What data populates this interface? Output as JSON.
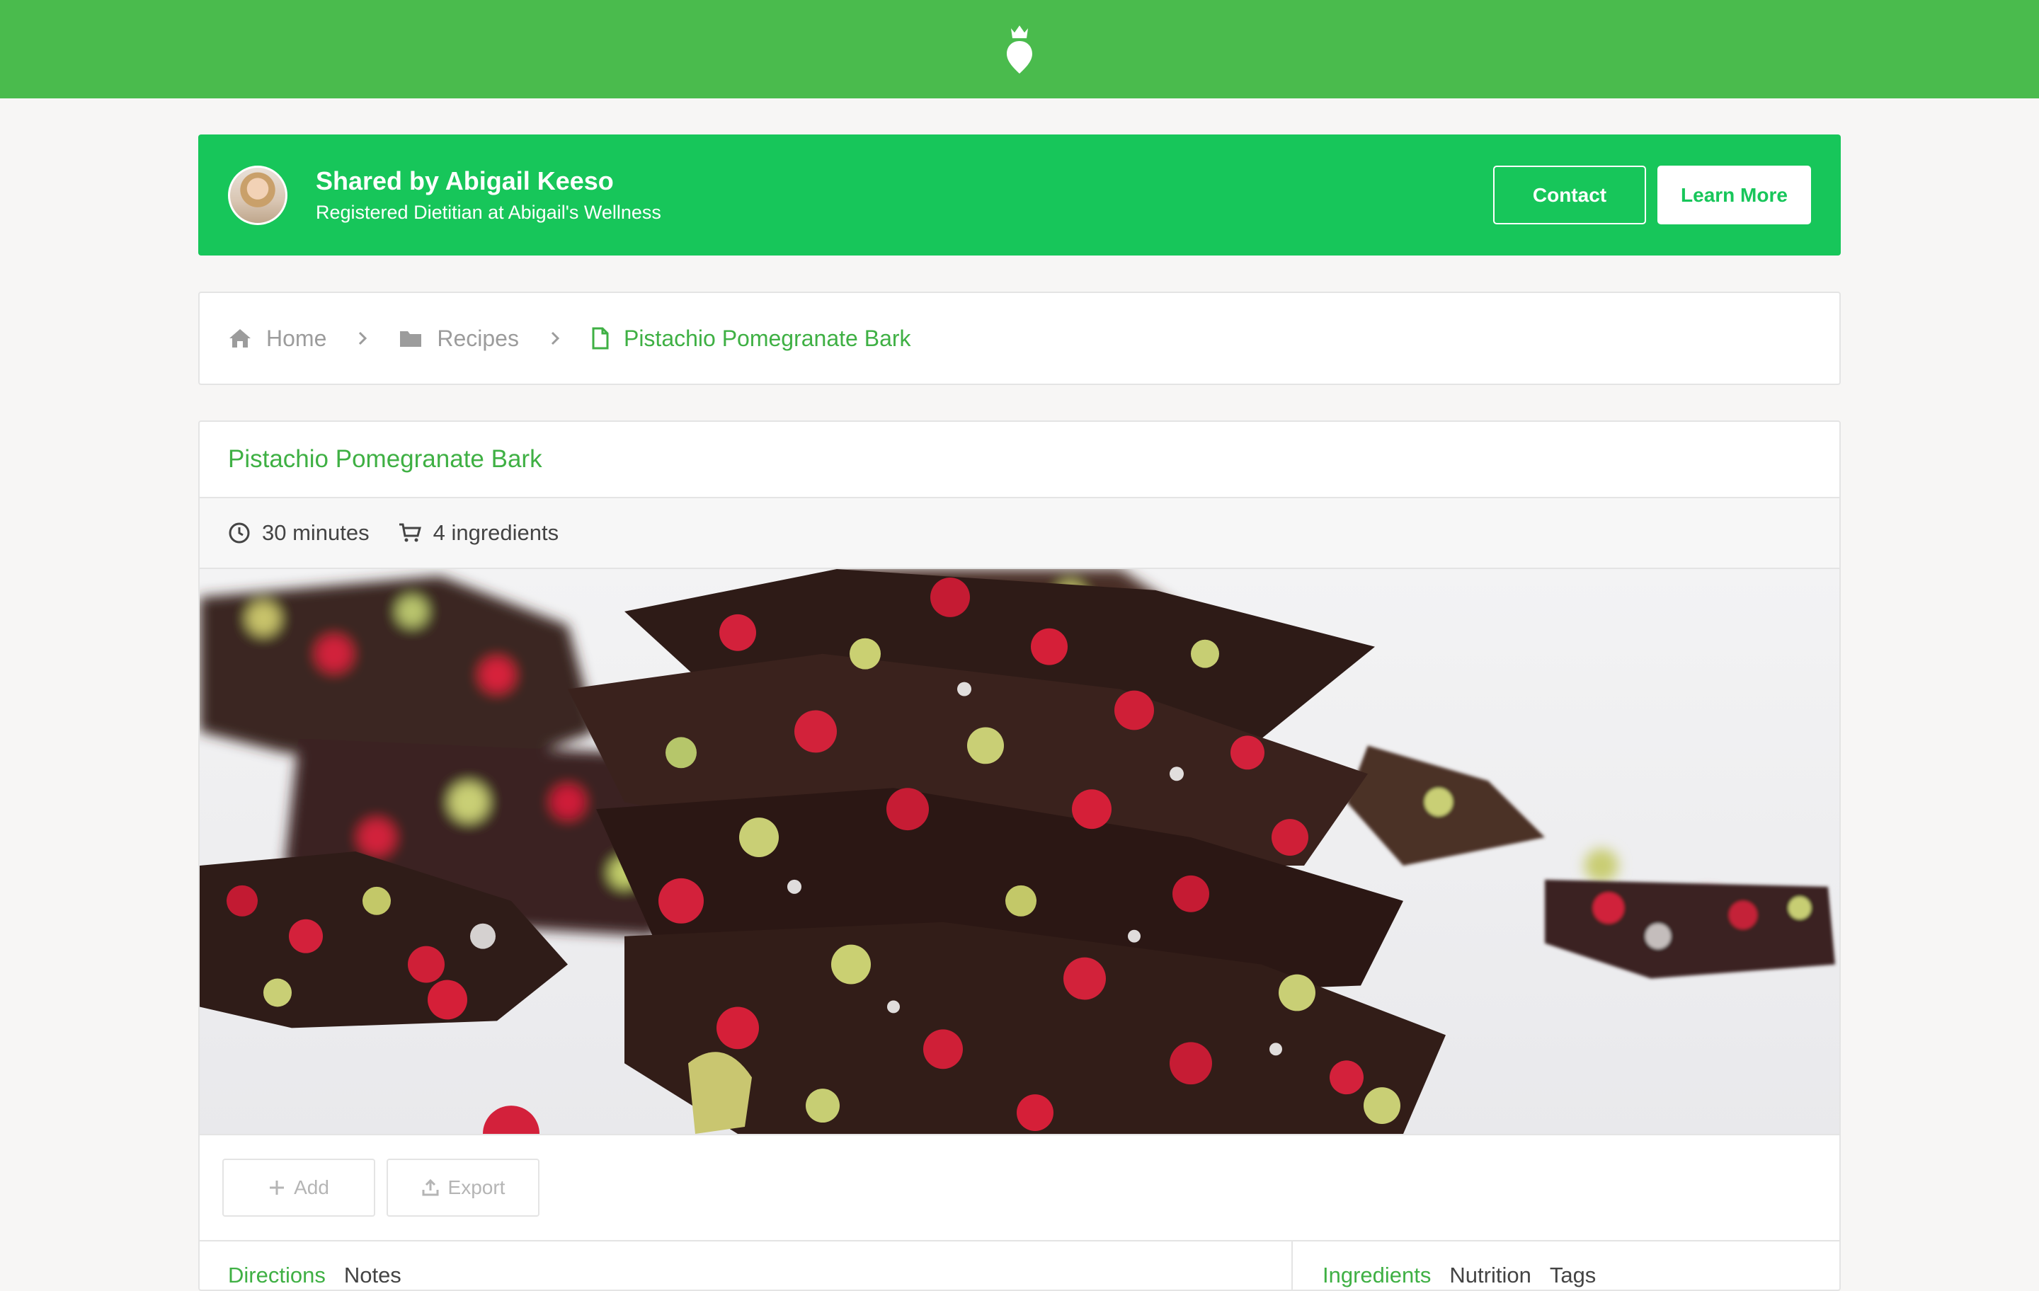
{
  "banner": {
    "title": "Shared by Abigail Keeso",
    "subtitle": "Registered Dietitian at Abigail's Wellness",
    "contact_label": "Contact",
    "learn_more_label": "Learn More"
  },
  "breadcrumb": {
    "home": "Home",
    "recipes": "Recipes",
    "current": "Pistachio Pomegranate Bark"
  },
  "recipe": {
    "title": "Pistachio Pomegranate Bark",
    "time": "30 minutes",
    "ingredients_count": "4 ingredients"
  },
  "actions": {
    "add_label": "Add",
    "export_label": "Export"
  },
  "tabs": {
    "left": [
      "Directions",
      "Notes"
    ],
    "right": [
      "Ingredients",
      "Nutrition",
      "Tags"
    ]
  },
  "colors": {
    "topbar": "#4abb4d",
    "banner": "#17c65a",
    "accent": "#3fb044"
  }
}
